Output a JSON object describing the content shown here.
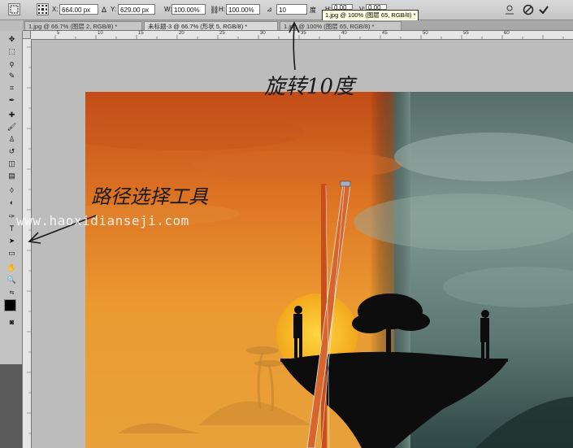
{
  "options_bar": {
    "x_label": "X:",
    "x_value": "664.00 px",
    "y_label": "Y:",
    "y_value": "629.00 px",
    "w_label": "W:",
    "w_value": "100.00%",
    "h_label": "H:",
    "h_value": "100.00%",
    "angle_value": "10",
    "angle_unit": "度",
    "hskew_label": "H:",
    "hskew_value": "0.00",
    "vskew_label": "V:",
    "vskew_value": "0.00",
    "cancel_icon": "cancel-icon",
    "commit_icon": "checkmark-icon"
  },
  "tooltip": "1.jpg @ 100% (图层 65, RGB/8) *",
  "tabs": [
    {
      "label": "1.jpg @ 66.7% (图层 2, RGB/8) *"
    },
    {
      "label": "未标题-3 @ 66.7% (形状 5, RGB/8) *"
    },
    {
      "label": "1.jpg @ 100% (图层 65, RGB/8) *"
    }
  ],
  "ruler_h_ticks": [
    "5",
    "10",
    "15",
    "20",
    "25",
    "30",
    "35",
    "40",
    "45",
    "50",
    "55",
    "60"
  ],
  "annotations": {
    "rotate_note": "旋转10度",
    "tool_note": "路径选择工具",
    "watermark": "www.haoxidianseji.com"
  },
  "colors": {
    "sunset_top": "#c9541a",
    "sunset_mid": "#e9892a",
    "sunset_low": "#f3b23d",
    "teal_sky": "#6f8a83",
    "teal_dark": "#3d5753",
    "sun": "#f9c21c"
  }
}
